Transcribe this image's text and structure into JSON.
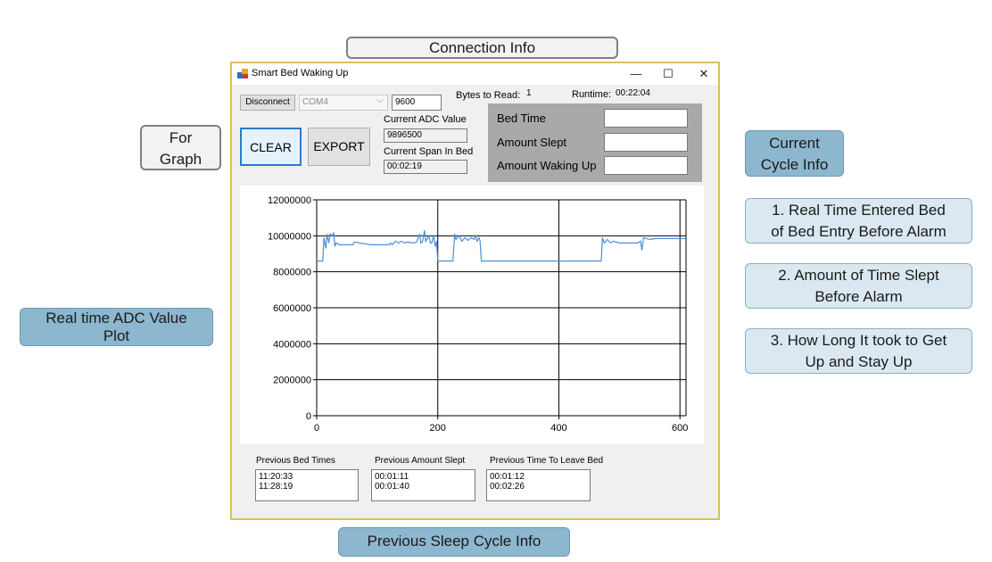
{
  "callouts": {
    "connection_info": "Connection Info",
    "for_graph_line1": "For",
    "for_graph_line2": "Graph",
    "current_cycle_line1": "Current",
    "current_cycle_line2": "Cycle Info",
    "item1_line1": "1.  Real Time Entered Bed",
    "item1_line2": "of Bed Entry Before Alarm",
    "item2_line1": "2. Amount of Time Slept",
    "item2_line2": "Before Alarm",
    "item3_line1": "3. How Long It took to Get",
    "item3_line2": "Up and Stay Up",
    "adc_plot_line1": "Real time ADC Value",
    "adc_plot_line2": "Plot",
    "previous_info": "Previous Sleep Cycle Info"
  },
  "window": {
    "title": "Smart Bed Waking Up",
    "minimize": "—",
    "maximize": "☐",
    "close": "✕"
  },
  "connection": {
    "disconnect_label": "Disconnect",
    "port_value": "COM4",
    "baud_value": "9600",
    "bytes_label": "Bytes to Read:",
    "bytes_value": "1",
    "runtime_label": "Runtime:",
    "runtime_value": "00:22:04"
  },
  "graph_buttons": {
    "clear_label": "CLEAR",
    "export_label": "EXPORT"
  },
  "adc": {
    "adc_label": "Current ADC Value",
    "adc_value": "9896500",
    "span_label": "Current Span In Bed",
    "span_value": "00:02:19"
  },
  "current_cycle": {
    "bed_time_label": "Bed Time",
    "amount_slept_label": "Amount Slept",
    "waking_label": "Amount Waking Up"
  },
  "previous": {
    "bed_times_label": "Previous Bed Times",
    "bed_times": [
      "11:20:33",
      "11:28:19"
    ],
    "slept_label": "Previous Amount Slept",
    "slept": [
      "00:01:11",
      "00:01:40"
    ],
    "leave_label": "Previous Time To Leave Bed",
    "leave": [
      "00:01:12",
      "00:02:26"
    ]
  },
  "colors": {
    "line": "#4a90d9",
    "panel": "#a9a9a9",
    "window_border": "#d8c25a"
  },
  "chart_data": {
    "type": "line",
    "xlim": [
      0,
      610
    ],
    "ylim": [
      0,
      12000000
    ],
    "x_ticks": [
      0,
      200,
      400,
      600
    ],
    "y_ticks": [
      0,
      2000000,
      4000000,
      6000000,
      8000000,
      10000000,
      12000000
    ],
    "x_tick_labels": [
      "0",
      "200",
      "400",
      "600"
    ],
    "y_tick_labels": [
      "0",
      "2000000",
      "4000000",
      "6000000",
      "8000000",
      "10000000",
      "12000000"
    ],
    "grid": true,
    "series": [
      {
        "x": [
          0,
          10,
          12,
          15,
          17,
          20,
          22,
          25,
          28,
          30,
          32,
          38,
          45,
          60,
          62,
          90,
          120,
          122,
          125,
          130,
          135,
          140,
          145,
          150,
          160,
          165,
          170,
          172,
          175,
          178,
          180,
          185,
          188,
          190,
          193,
          196,
          198,
          200,
          225,
          228,
          230,
          235,
          240,
          245,
          250,
          255,
          260,
          262,
          265,
          268,
          270,
          272,
          300,
          400,
          470,
          472,
          475,
          480,
          485,
          490,
          500,
          510,
          530,
          535,
          537,
          540,
          550,
          560,
          580,
          600,
          610
        ],
        "y": [
          8600000,
          8600000,
          9900000,
          9300000,
          10100000,
          9600000,
          10100000,
          10000000,
          10150000,
          9400000,
          9600000,
          9500000,
          9500000,
          9500000,
          9650000,
          9500000,
          9500000,
          9600000,
          9500000,
          9700000,
          9600000,
          9700000,
          9600000,
          9650000,
          9600000,
          9650000,
          10100000,
          9600000,
          9700000,
          10300000,
          9700000,
          10000000,
          9600000,
          9600000,
          10000000,
          9400000,
          9700000,
          8600000,
          8600000,
          10100000,
          9800000,
          10000000,
          9700000,
          9900000,
          9750000,
          9900000,
          9800000,
          10000000,
          9700000,
          9900000,
          9700000,
          8600000,
          8600000,
          8600000,
          8600000,
          9900000,
          9600000,
          9800000,
          9600000,
          9700000,
          9600000,
          9600000,
          9600000,
          9700000,
          9200000,
          9900000,
          9800000,
          9850000,
          9850000,
          9850000,
          9850000
        ]
      }
    ]
  }
}
